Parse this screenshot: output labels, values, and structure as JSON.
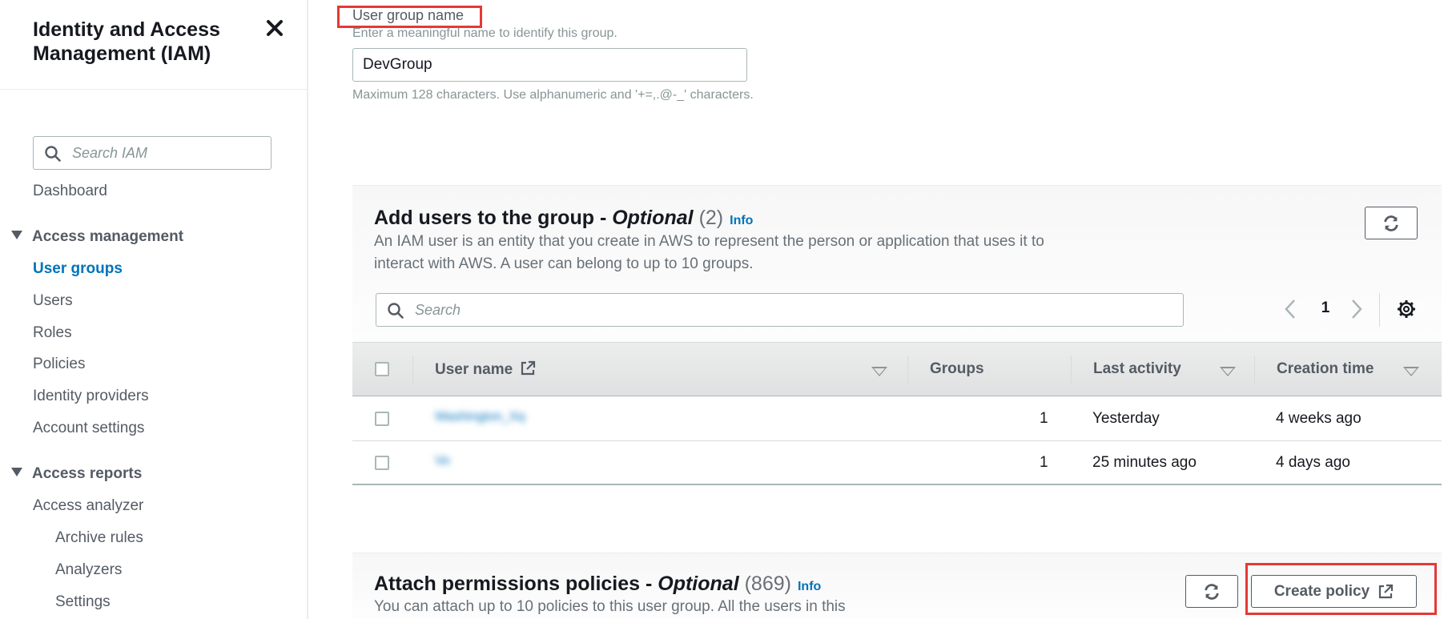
{
  "sidebar": {
    "title": "Identity and Access Management (IAM)",
    "close_icon": "close-icon",
    "search_placeholder": "Search IAM",
    "dashboard": "Dashboard",
    "access_management": {
      "label": "Access management",
      "items": [
        "User groups",
        "Users",
        "Roles",
        "Policies",
        "Identity providers",
        "Account settings"
      ],
      "active": "User groups"
    },
    "access_reports": {
      "label": "Access reports",
      "items": [
        "Access analyzer"
      ],
      "sub_items": [
        "Archive rules",
        "Analyzers",
        "Settings"
      ]
    }
  },
  "group_name": {
    "label": "User group name",
    "hint": "Enter a meaningful name to identify this group.",
    "value": "DevGroup",
    "constraint": "Maximum 128 characters. Use alphanumeric and '+=,.@-_' characters."
  },
  "add_users": {
    "title": "Add users to the group - ",
    "optional": "Optional",
    "count": "(2)",
    "info": "Info",
    "description": "An IAM user is an entity that you create in AWS to represent the person or application that uses it to interact with AWS. A user can belong to up to 10 groups.",
    "search_placeholder": "Search",
    "page": "1",
    "columns": [
      "User name",
      "Groups",
      "Last activity",
      "Creation time"
    ],
    "rows": [
      {
        "user": "Washington_Xq",
        "groups": "1",
        "last_activity": "Yesterday",
        "created": "4 weeks ago"
      },
      {
        "user": "Vo",
        "groups": "1",
        "last_activity": "25 minutes ago",
        "created": "4 days ago"
      }
    ]
  },
  "attach_policies": {
    "title": "Attach permissions policies - ",
    "optional": "Optional",
    "count": "(869)",
    "info": "Info",
    "description": "You can attach up to 10 policies to this user group. All the users in this",
    "create_policy": "Create policy"
  },
  "colors": {
    "link": "#0073bb",
    "highlight": "#e53935",
    "text": "#16191f",
    "muted": "#545b64"
  }
}
